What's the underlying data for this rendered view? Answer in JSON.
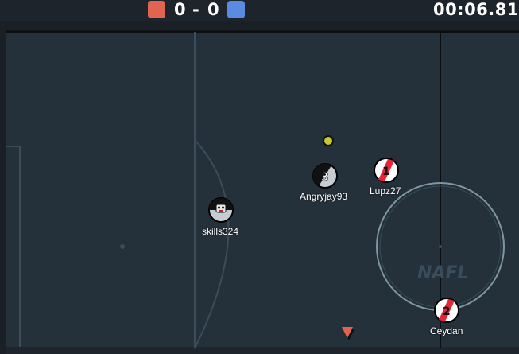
{
  "scoreboard": {
    "red_score": "0",
    "separator": "-",
    "blue_score": "0",
    "timer": "00:06.81",
    "red_color": "#e0644f",
    "blue_color": "#5b8be0"
  },
  "field": {
    "background_color": "#24303a",
    "line_color": "#3b4c5a",
    "watermark": "NAFL"
  },
  "players": [
    {
      "name": "skills324",
      "number": "",
      "team": "red",
      "avatar": "face-icon"
    },
    {
      "name": "Angryjay93",
      "number": "3",
      "team": "red",
      "avatar": "jersey-icon"
    },
    {
      "name": "Lupz27",
      "number": "1",
      "team": "blue",
      "avatar": "jersey-icon"
    },
    {
      "name": "Ceydan",
      "number": "2",
      "team": "blue",
      "avatar": "jersey-icon"
    }
  ],
  "ball": {
    "color": "#c8c82a"
  }
}
